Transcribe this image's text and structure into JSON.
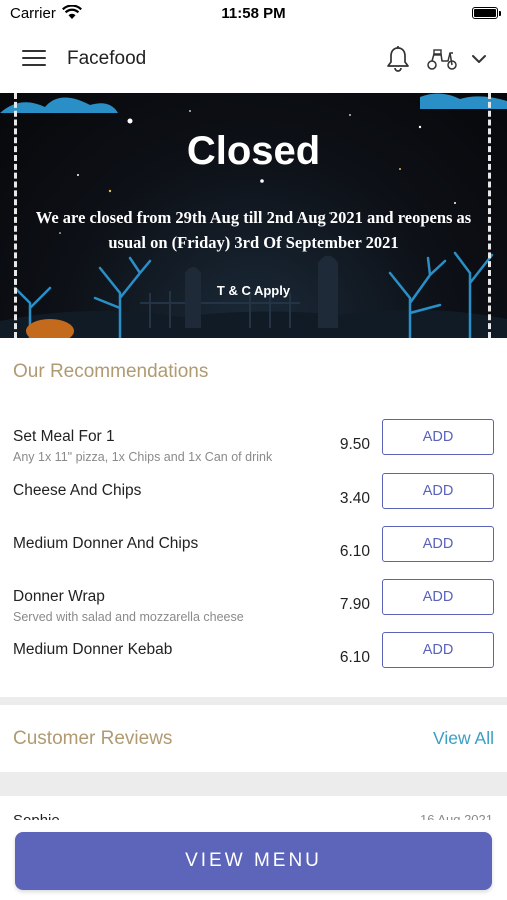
{
  "status_bar": {
    "carrier": "Carrier",
    "time": "11:58 PM"
  },
  "header": {
    "title": "Facefood",
    "icons": [
      "menu-icon",
      "bell-icon",
      "scooter-icon",
      "chevron-down-icon"
    ]
  },
  "banner": {
    "title": "Closed",
    "message": "We are closed from 29th Aug till 2nd Aug 2021 and reopens as usual on (Friday) 3rd Of September 2021",
    "terms": "T & C Apply"
  },
  "recommendations": {
    "title": "Our Recommendations",
    "items": [
      {
        "name": "Set Meal For 1",
        "description": "Any 1x 11\" pizza, 1x Chips and 1x Can of drink",
        "price": "9.50",
        "button": "ADD"
      },
      {
        "name": "Cheese And Chips",
        "description": "",
        "price": "3.40",
        "button": "ADD"
      },
      {
        "name": "Medium Donner And Chips",
        "description": "",
        "price": "6.10",
        "button": "ADD"
      },
      {
        "name": "Donner Wrap",
        "description": "Served with salad and mozzarella cheese",
        "price": "7.90",
        "button": "ADD"
      },
      {
        "name": "Medium Donner Kebab",
        "description": "",
        "price": "6.10",
        "button": "ADD"
      }
    ]
  },
  "reviews": {
    "title": "Customer Reviews",
    "view_all": "View All",
    "first": {
      "name": "Sophie",
      "date": "16 Aug 2021"
    }
  },
  "footer": {
    "view_menu": "VIEW MENU"
  },
  "colors": {
    "accent": "#5d65bb",
    "section_title": "#b09a72",
    "link": "#3a9fc2"
  }
}
